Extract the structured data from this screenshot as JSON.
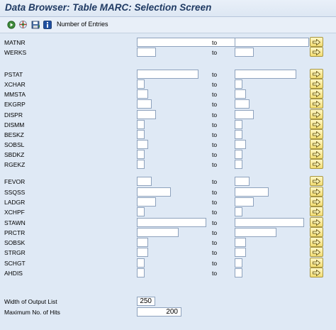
{
  "title": "Data Browser: Table MARC: Selection Screen",
  "toolbar": {
    "execute_icon": "execute-icon",
    "choose_icon": "field-selection-icon",
    "save_icon": "save-variant-icon",
    "info_icon": "info-icon",
    "number_of_entries_label": "Number of Entries"
  },
  "to_label": "to",
  "multi_select_icon": "arrow-right-icon",
  "fields": [
    {
      "label": "MATNR"
    },
    {
      "label": "WERKS"
    },
    {
      "label": "PSTAT"
    },
    {
      "label": "XCHAR"
    },
    {
      "label": "MMSTA"
    },
    {
      "label": "EKGRP"
    },
    {
      "label": "DISPR"
    },
    {
      "label": "DISMM"
    },
    {
      "label": "BESKZ"
    },
    {
      "label": "SOBSL"
    },
    {
      "label": "SBDKZ"
    },
    {
      "label": "RGEKZ"
    },
    {
      "label": "FEVOR"
    },
    {
      "label": "SSQSS"
    },
    {
      "label": "LADGR"
    },
    {
      "label": "XCHPF"
    },
    {
      "label": "STAWN"
    },
    {
      "label": "PRCTR"
    },
    {
      "label": "SOBSK"
    },
    {
      "label": "STRGR"
    },
    {
      "label": "SCHGT"
    },
    {
      "label": "AHDIS"
    }
  ],
  "output": {
    "width_label": "Width of Output List",
    "width_value": "250",
    "max_hits_label": "Maximum No. of Hits",
    "max_hits_value": "200"
  },
  "colors": {
    "background": "#dfe9f5",
    "title_text": "#1f3a63",
    "button_yellow": "#f2dc71"
  }
}
